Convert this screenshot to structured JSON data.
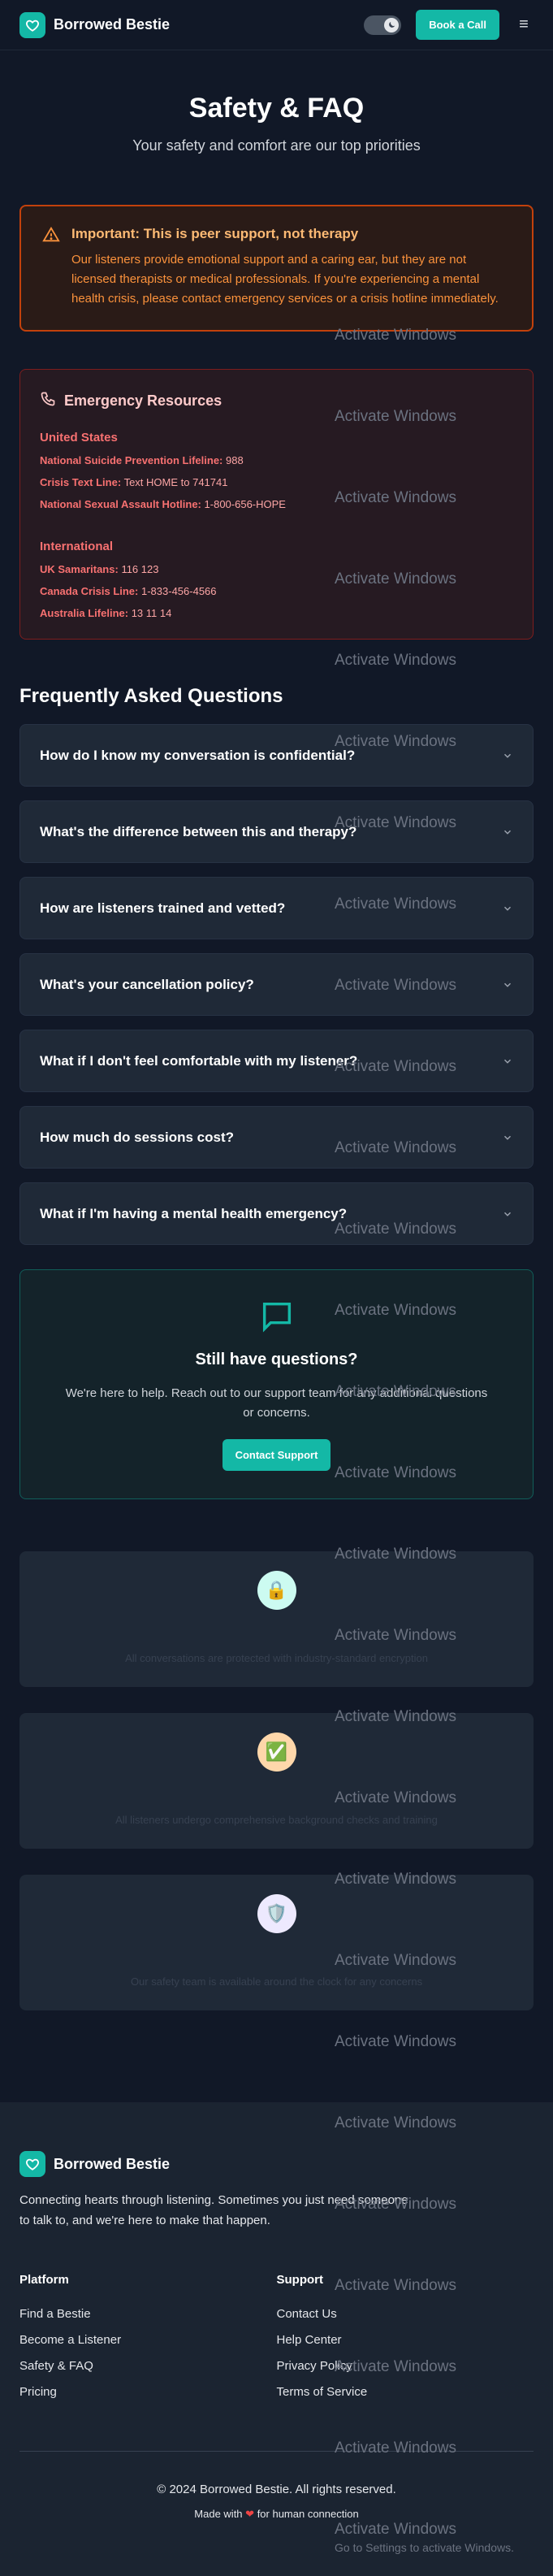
{
  "header": {
    "brand": "Borrowed Bestie",
    "book_label": "Book a Call",
    "menu_glyph": "≡"
  },
  "hero": {
    "title": "Safety & FAQ",
    "subtitle": "Your safety and comfort are our top priorities"
  },
  "important": {
    "title": "Important: This is peer support, not therapy",
    "body": "Our listeners provide emotional support and a caring ear, but they are not licensed therapists or medical professionals. If you're experiencing a mental health crisis, please contact emergency services or a crisis hotline immediately."
  },
  "emergency": {
    "title": "Emergency Resources",
    "regions": [
      {
        "name": "United States",
        "lines": [
          {
            "label": "National Suicide Prevention Lifeline:",
            "value": "988"
          },
          {
            "label": "Crisis Text Line:",
            "value": "Text HOME to 741741"
          },
          {
            "label": "National Sexual Assault Hotline:",
            "value": "1-800-656-HOPE"
          }
        ]
      },
      {
        "name": "International",
        "lines": [
          {
            "label": "UK Samaritans:",
            "value": "116 123"
          },
          {
            "label": "Canada Crisis Line:",
            "value": "1-833-456-4566"
          },
          {
            "label": "Australia Lifeline:",
            "value": "13 11 14"
          }
        ]
      }
    ]
  },
  "faq": {
    "title": "Frequently Asked Questions",
    "items": [
      "How do I know my conversation is confidential?",
      "What's the difference between this and therapy?",
      "How are listeners trained and vetted?",
      "What's your cancellation policy?",
      "What if I don't feel comfortable with my listener?",
      "How much do sessions cost?",
      "What if I'm having a mental health emergency?"
    ]
  },
  "support": {
    "title": "Still have questions?",
    "body": "We're here to help. Reach out to our support team for any additional questions or concerns.",
    "button": "Contact Support"
  },
  "features": [
    {
      "icon": "lock-icon",
      "emoji": "🔒",
      "bg": "#ccfbf1",
      "text": "All conversations are protected with industry-standard encryption"
    },
    {
      "icon": "check-icon",
      "emoji": "✅",
      "bg": "#fed7aa",
      "text": "All listeners undergo comprehensive background checks and training"
    },
    {
      "icon": "shield-icon",
      "emoji": "🛡️",
      "bg": "#ede9fe",
      "text": "Our safety team is available around the clock for any concerns"
    }
  ],
  "footer": {
    "brand": "Borrowed Bestie",
    "description": "Connecting hearts through listening. Sometimes you just need someone to talk to, and we're here to make that happen.",
    "platform_title": "Platform",
    "platform_links": [
      "Find a Bestie",
      "Become a Listener",
      "Safety & FAQ",
      "Pricing"
    ],
    "support_title": "Support",
    "support_links": [
      "Contact Us",
      "Help Center",
      "Privacy Policy",
      "Terms of Service"
    ],
    "copyright": "© 2024 Borrowed Bestie. All rights reserved.",
    "made_prefix": "Made with",
    "made_heart": "❤",
    "made_suffix": "for human connection"
  },
  "watermark": {
    "title": "Activate Windows",
    "subtitle": "Go to Settings to activate Windows."
  },
  "colors": {
    "accent": "#14b8a6",
    "background": "#111827",
    "card": "#1f2937",
    "warning": "#fb923c",
    "danger": "#f87171"
  }
}
